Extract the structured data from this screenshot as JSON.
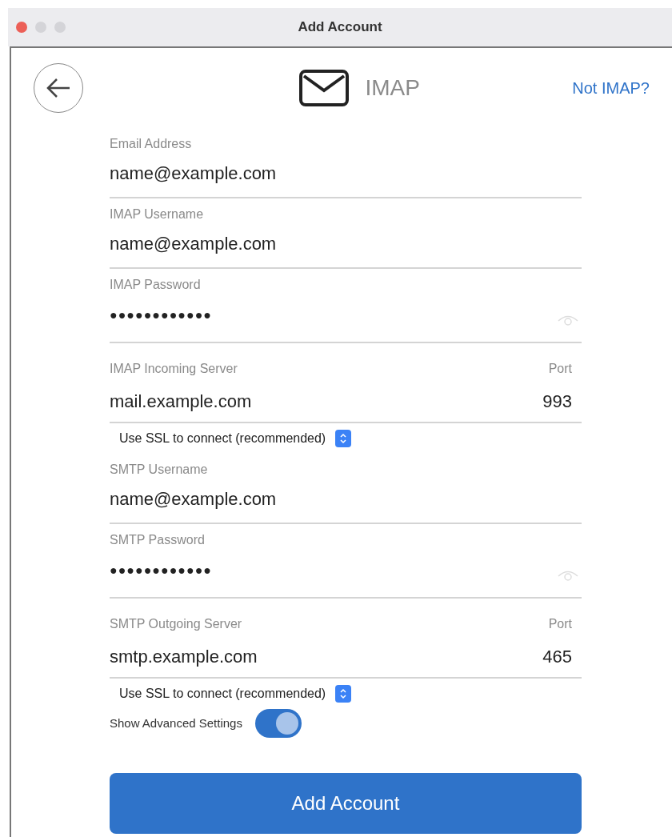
{
  "window": {
    "title": "Add Account"
  },
  "header": {
    "title": "IMAP",
    "link": "Not IMAP?"
  },
  "fields": [
    {
      "kind": "text",
      "label": "Email Address",
      "value": "name@example.com"
    },
    {
      "kind": "text",
      "label": "IMAP Username",
      "value": "name@example.com"
    },
    {
      "kind": "password",
      "label": "IMAP Password",
      "value": "●●●●●●●●●●●●"
    },
    {
      "kind": "server",
      "label": "IMAP Incoming Server",
      "value": "mail.example.com",
      "port_label": "Port",
      "port": "993"
    },
    {
      "kind": "select",
      "value": "Use SSL to connect (recommended)"
    },
    {
      "kind": "text",
      "label": "SMTP Username",
      "value": "name@example.com"
    },
    {
      "kind": "password",
      "label": "SMTP Password",
      "value": "●●●●●●●●●●●●"
    },
    {
      "kind": "server",
      "label": "SMTP Outgoing Server",
      "value": "smtp.example.com",
      "port_label": "Port",
      "port": "465"
    },
    {
      "kind": "select",
      "value": "Use SSL to connect (recommended)"
    }
  ],
  "advanced": {
    "label": "Show Advanced Settings",
    "on": true
  },
  "submit": "Add Account"
}
